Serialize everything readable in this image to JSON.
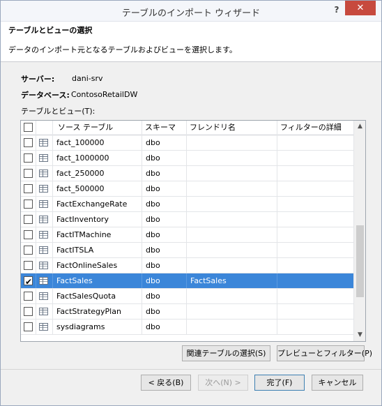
{
  "window": {
    "title": "テーブルのインポート ウィザード",
    "help": "?",
    "close": "✕"
  },
  "header": {
    "title": "テーブルとビューの選択",
    "description": "データのインポート元となるテーブルおよびビューを選択します。"
  },
  "info": {
    "server_label": "サーバー:",
    "server_value": "dani-srv",
    "database_label": "データベース:",
    "database_value": "ContosoRetailDW"
  },
  "grid": {
    "label": "テーブルとビュー(T):",
    "columns": [
      "ソース テーブル",
      "スキーマ",
      "フレンドリ名",
      "フィルターの詳細"
    ],
    "rows": [
      {
        "name": "fact_100000",
        "schema": "dbo",
        "friendly": "",
        "checked": false,
        "selected": false
      },
      {
        "name": "fact_1000000",
        "schema": "dbo",
        "friendly": "",
        "checked": false,
        "selected": false
      },
      {
        "name": "fact_250000",
        "schema": "dbo",
        "friendly": "",
        "checked": false,
        "selected": false
      },
      {
        "name": "fact_500000",
        "schema": "dbo",
        "friendly": "",
        "checked": false,
        "selected": false
      },
      {
        "name": "FactExchangeRate",
        "schema": "dbo",
        "friendly": "",
        "checked": false,
        "selected": false
      },
      {
        "name": "FactInventory",
        "schema": "dbo",
        "friendly": "",
        "checked": false,
        "selected": false
      },
      {
        "name": "FactITMachine",
        "schema": "dbo",
        "friendly": "",
        "checked": false,
        "selected": false
      },
      {
        "name": "FactITSLA",
        "schema": "dbo",
        "friendly": "",
        "checked": false,
        "selected": false
      },
      {
        "name": "FactOnlineSales",
        "schema": "dbo",
        "friendly": "",
        "checked": false,
        "selected": false
      },
      {
        "name": "FactSales",
        "schema": "dbo",
        "friendly": "FactSales",
        "checked": true,
        "selected": true
      },
      {
        "name": "FactSalesQuota",
        "schema": "dbo",
        "friendly": "",
        "checked": false,
        "selected": false
      },
      {
        "name": "FactStrategyPlan",
        "schema": "dbo",
        "friendly": "",
        "checked": false,
        "selected": false
      },
      {
        "name": "sysdiagrams",
        "schema": "dbo",
        "friendly": "",
        "checked": false,
        "selected": false
      }
    ]
  },
  "actions": {
    "related_tables": "関連テーブルの選択(S)",
    "preview_filter": "プレビューとフィルター(P)",
    "back": "< 戻る(B)",
    "next": "次へ(N) >",
    "finish": "完了(F)",
    "cancel": "キャンセル"
  },
  "colors": {
    "selection": "#3b86d9",
    "close_button": "#c74a3e"
  }
}
